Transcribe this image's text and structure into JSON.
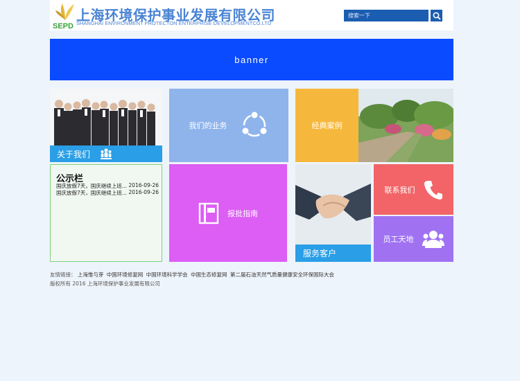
{
  "header": {
    "company_cn": "上海环境保护事业发展有限公司",
    "company_en": "SHANGHAI ENVIRONMENT PROTECTON ENTERPRISE DEVELOPMENTCO.LTD",
    "logo_text": "SEPD",
    "search_placeholder": "搜索一下"
  },
  "banner": {
    "text": "banner"
  },
  "tiles": {
    "about": "关于我们",
    "business": "我们的业务",
    "cases": "经典案例",
    "guide": "报批指南",
    "service": "服务客户",
    "contact": "联系我们",
    "staff": "员工天地"
  },
  "notice": {
    "title": "公示栏",
    "items": [
      {
        "text": "国庆放假7天，国庆继续上班...",
        "date": "2016-09-26"
      },
      {
        "text": "国庆放假7天，国庆继续上班...",
        "date": "2016-09-26"
      }
    ]
  },
  "footer": {
    "links_label": "友情链接：",
    "links": [
      "上海惟与芽",
      "中国环境修复网",
      "中国环境科学学会",
      "中国生态修复网",
      "第二届石油天然气质量健康安全环保国际大会"
    ],
    "copyright": "版权所有 2016 上海环境保护事业发展有限公司"
  },
  "colors": {
    "banner": "#0b4bff",
    "business": "#8fb4ec",
    "cases": "#f6b83c",
    "guide": "#dc5ef4",
    "contact": "#f26467",
    "staff": "#a072f2",
    "bar_blue": "#2a9ee6"
  },
  "icons": {
    "business": "share-network-icon",
    "about": "people-group-icon",
    "guide": "book-icon",
    "contact": "phone-icon",
    "staff": "users-icon",
    "search": "search-icon"
  }
}
